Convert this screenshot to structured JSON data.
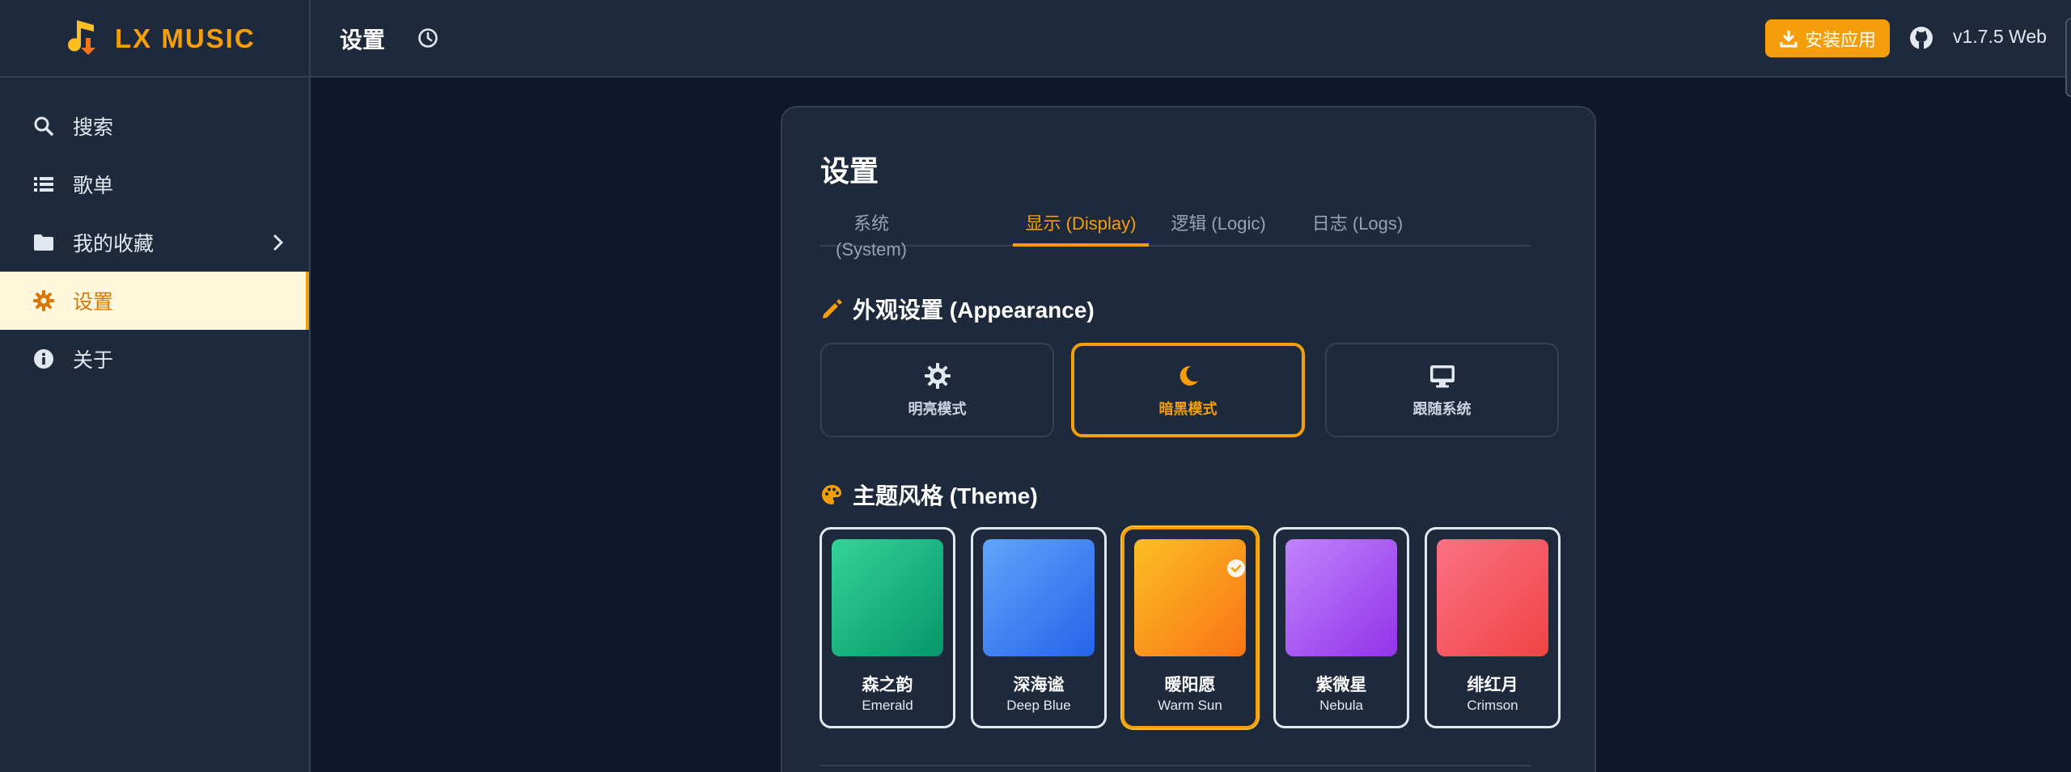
{
  "brand": {
    "name": "LX MUSIC",
    "accent": "#f59e0b"
  },
  "header": {
    "title": "设置",
    "install_label": "安装应用",
    "version": "v1.7.5 Web"
  },
  "sidebar": {
    "items": [
      {
        "label": "搜索",
        "icon": "search-icon"
      },
      {
        "label": "歌单",
        "icon": "list-icon"
      },
      {
        "label": "我的收藏",
        "icon": "folder-icon"
      },
      {
        "label": "设置",
        "icon": "gear-icon",
        "active": true
      },
      {
        "label": "关于",
        "icon": "info-icon"
      }
    ]
  },
  "settings": {
    "title": "设置",
    "tabs": [
      {
        "label": "系统 (System)"
      },
      {
        "label": "显示 (Display)",
        "active": true
      },
      {
        "label": "逻辑 (Logic)"
      },
      {
        "label": "日志 (Logs)"
      }
    ],
    "appearance": {
      "title": "外观设置 (Appearance)",
      "modes": [
        {
          "label": "明亮模式",
          "icon": "sun-icon"
        },
        {
          "label": "暗黑模式",
          "icon": "moon-icon",
          "active": true
        },
        {
          "label": "跟随系统",
          "icon": "monitor-icon"
        }
      ]
    },
    "theme": {
      "title": "主题风格 (Theme)",
      "options": [
        {
          "name": "森之韵",
          "en": "Emerald",
          "colors": [
            "#34d399",
            "#059669"
          ]
        },
        {
          "name": "深海谧",
          "en": "Deep Blue",
          "colors": [
            "#60a5fa",
            "#2563eb"
          ]
        },
        {
          "name": "暖阳愿",
          "en": "Warm Sun",
          "colors": [
            "#fbbf24",
            "#f97316"
          ],
          "selected": true
        },
        {
          "name": "紫微星",
          "en": "Nebula",
          "colors": [
            "#c084fc",
            "#9333ea"
          ]
        },
        {
          "name": "绯红月",
          "en": "Crimson",
          "colors": [
            "#fb7185",
            "#ef4444"
          ]
        }
      ]
    }
  }
}
